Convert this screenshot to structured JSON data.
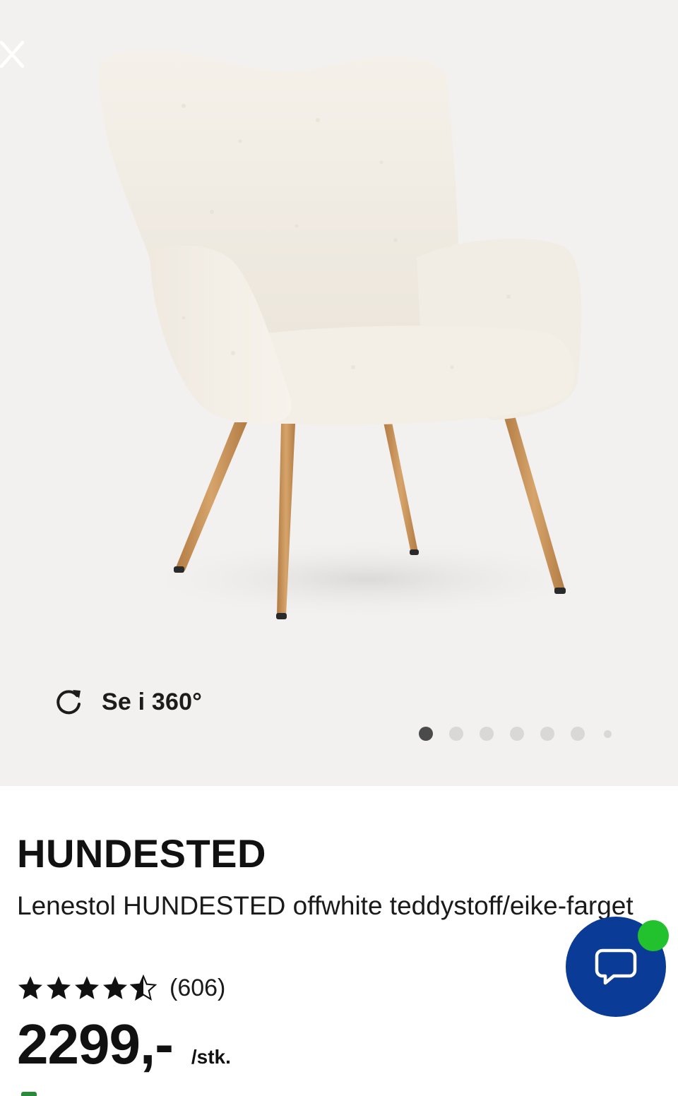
{
  "gallery": {
    "close_icon": "close-icon",
    "view360_icon": "rotate-icon",
    "view360_label": "Se i 360°",
    "image_count": 7,
    "active_index": 0
  },
  "product": {
    "brand": "HUNDESTED",
    "description": "Lenestol HUNDESTED offwhite teddystoff/eike-farget",
    "rating": {
      "stars_out_of_5": 4.5,
      "review_count": "(606)"
    },
    "price": "2299,-",
    "unit": "/stk."
  },
  "chat": {
    "icon": "chat-bubble-icon",
    "online": true
  },
  "colors": {
    "gallery_bg": "#f2f1f0",
    "chat_blue": "#0a3b96",
    "online_green": "#22c12e",
    "fabric": "#f4efe7",
    "wood": "#c9935a"
  }
}
